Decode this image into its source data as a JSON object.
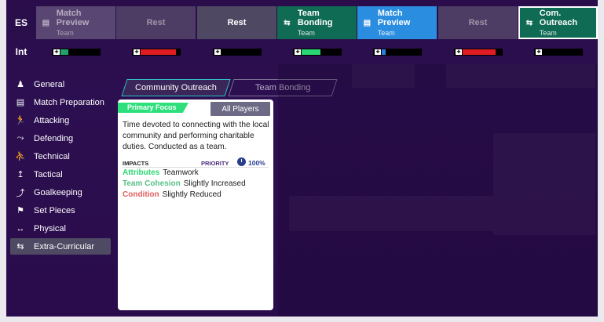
{
  "rows": {
    "es_label": "ES",
    "int_label": "Int"
  },
  "schedule": [
    {
      "title": "Match Preview",
      "subtitle": "Team",
      "style": "dim",
      "icon": "clipboard-icon",
      "glyph": "▤"
    },
    {
      "title": "Rest",
      "subtitle": "",
      "style": "rest-dim",
      "icon": "",
      "glyph": ""
    },
    {
      "title": "Rest",
      "subtitle": "",
      "style": "rest",
      "icon": "",
      "glyph": ""
    },
    {
      "title": "Team Bonding",
      "subtitle": "Team",
      "style": "bonding",
      "icon": "bonding-icon",
      "glyph": "⇆"
    },
    {
      "title": "Match Preview",
      "subtitle": "Team",
      "style": "preview",
      "icon": "clipboard-icon",
      "glyph": "▤"
    },
    {
      "title": "Rest",
      "subtitle": "",
      "style": "rest-dim",
      "icon": "",
      "glyph": ""
    },
    {
      "title": "Com. Outreach",
      "subtitle": "Team",
      "style": "outreach",
      "icon": "bonding-icon",
      "glyph": "⇆"
    }
  ],
  "intensity": [
    {
      "level": 0.2,
      "color": "#1fa36a"
    },
    {
      "level": 0.88,
      "color": "#e01c22"
    },
    {
      "level": 0,
      "color": "#000000"
    },
    {
      "level": 0.48,
      "color": "#2ad673"
    },
    {
      "level": 0.1,
      "color": "#2b7de0"
    },
    {
      "level": 0.82,
      "color": "#e01c22"
    },
    {
      "level": 0,
      "color": "#000000"
    }
  ],
  "sidebar": {
    "items": [
      {
        "label": "General",
        "icon": "person-icon",
        "glyph": "♟"
      },
      {
        "label": "Match Preparation",
        "icon": "clipboard-icon",
        "glyph": "▤"
      },
      {
        "label": "Attacking",
        "icon": "running-icon",
        "glyph": "🏃"
      },
      {
        "label": "Defending",
        "icon": "slide-tackle-icon",
        "glyph": "⤳"
      },
      {
        "label": "Technical",
        "icon": "kicking-icon",
        "glyph": "⛹"
      },
      {
        "label": "Tactical",
        "icon": "tactics-icon",
        "glyph": "↥"
      },
      {
        "label": "Goalkeeping",
        "icon": "goalkeeper-icon",
        "glyph": "⤴"
      },
      {
        "label": "Set Pieces",
        "icon": "set-pieces-icon",
        "glyph": "⚑"
      },
      {
        "label": "Physical",
        "icon": "physical-icon",
        "glyph": "↔"
      },
      {
        "label": "Extra-Curricular",
        "icon": "bonding-icon",
        "glyph": "⇆"
      }
    ],
    "active_index": 9
  },
  "tabs": {
    "active": "Community Outreach",
    "inactive": "Team Bonding"
  },
  "card": {
    "primary_focus": "Primary Focus",
    "all_players": "All Players",
    "description": "Time devoted to connecting with the local community and performing charitable duties. Conducted as a team.",
    "impacts_label": "IMPACTS",
    "priority_label": "PRIORITY",
    "priority_value": "100%",
    "impacts": [
      {
        "key": "Attributes",
        "value": "Teamwork",
        "color": "#2ad673"
      },
      {
        "key": "Team Cohesion",
        "value": "Slightly Increased",
        "color": "#58c08a"
      },
      {
        "key": "Condition",
        "value": "Slightly Reduced",
        "color": "#e25d5d"
      }
    ]
  },
  "colors": {
    "background": "#2c0f50",
    "accent_teal": "#31c0c8",
    "bonding_green": "#0f6b54",
    "preview_blue": "#2b8de0"
  }
}
